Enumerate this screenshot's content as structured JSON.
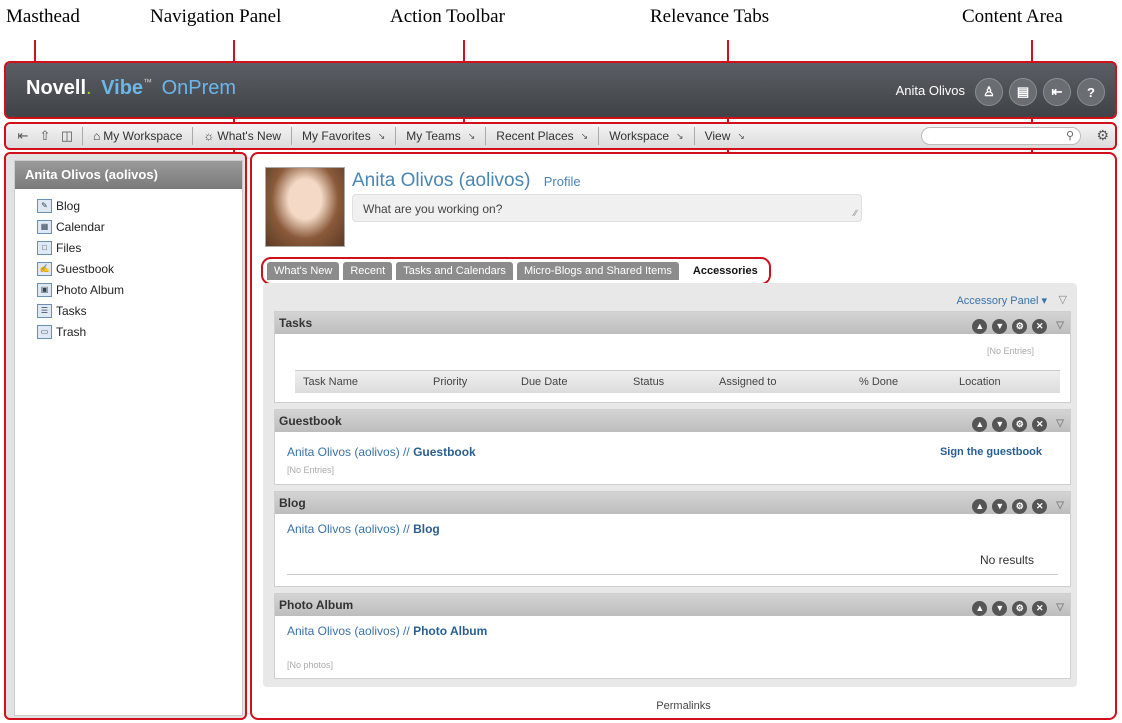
{
  "callouts": {
    "masthead": "Masthead",
    "navigation": "Navigation Panel",
    "toolbar": "Action Toolbar",
    "tabs": "Relevance Tabs",
    "content": "Content Area"
  },
  "masthead": {
    "brand_novell": "Novell",
    "brand_dot": ".",
    "brand_vibe": "Vibe",
    "brand_tm": "™",
    "brand_onprem": "OnPrem",
    "user": "Anita Olivos",
    "icons": [
      "personal-preferences-icon",
      "news-icon",
      "logout-icon",
      "help-icon"
    ]
  },
  "toolbar": {
    "items": {
      "my_workspace": "My Workspace",
      "whats_new": "What's New",
      "my_favorites": "My Favorites",
      "my_teams": "My Teams",
      "recent_places": "Recent Places",
      "workspace": "Workspace",
      "view": "View"
    },
    "search_placeholder": ""
  },
  "nav": {
    "header": "Anita Olivos (aolivos)",
    "items": [
      "Blog",
      "Calendar",
      "Files",
      "Guestbook",
      "Photo Album",
      "Tasks",
      "Trash"
    ]
  },
  "profile": {
    "name": "Anita Olivos (aolivos)",
    "profile_link": "Profile",
    "status_placeholder": "What are you working on?"
  },
  "tabs": [
    "What's New",
    "Recent",
    "Tasks and Calendars",
    "Micro-Blogs and Shared Items",
    "Accessories"
  ],
  "accessories": {
    "panel_link": "Accessory Panel",
    "tasks": {
      "title": "Tasks",
      "no_entries": "[No Entries]",
      "columns": [
        "Task Name",
        "Priority",
        "Due Date",
        "Status",
        "Assigned to",
        "% Done",
        "Location"
      ]
    },
    "guestbook": {
      "title": "Guestbook",
      "crumb_user": "Anita Olivos (aolivos) //",
      "crumb_target": "Guestbook",
      "sign": "Sign the guestbook",
      "no_entries": "[No Entries]"
    },
    "blog": {
      "title": "Blog",
      "crumb_user": "Anita Olivos (aolivos) //",
      "crumb_target": "Blog",
      "no_results": "No results"
    },
    "photo_album": {
      "title": "Photo Album",
      "crumb_user": "Anita Olivos (aolivos) //",
      "crumb_target": "Photo Album",
      "no_photos": "[No photos]"
    }
  },
  "footer": {
    "permalinks": "Permalinks"
  },
  "colors": {
    "callout_red": "#d0101a",
    "link_blue": "#3a72a8",
    "masthead_dark": "#45494e"
  }
}
